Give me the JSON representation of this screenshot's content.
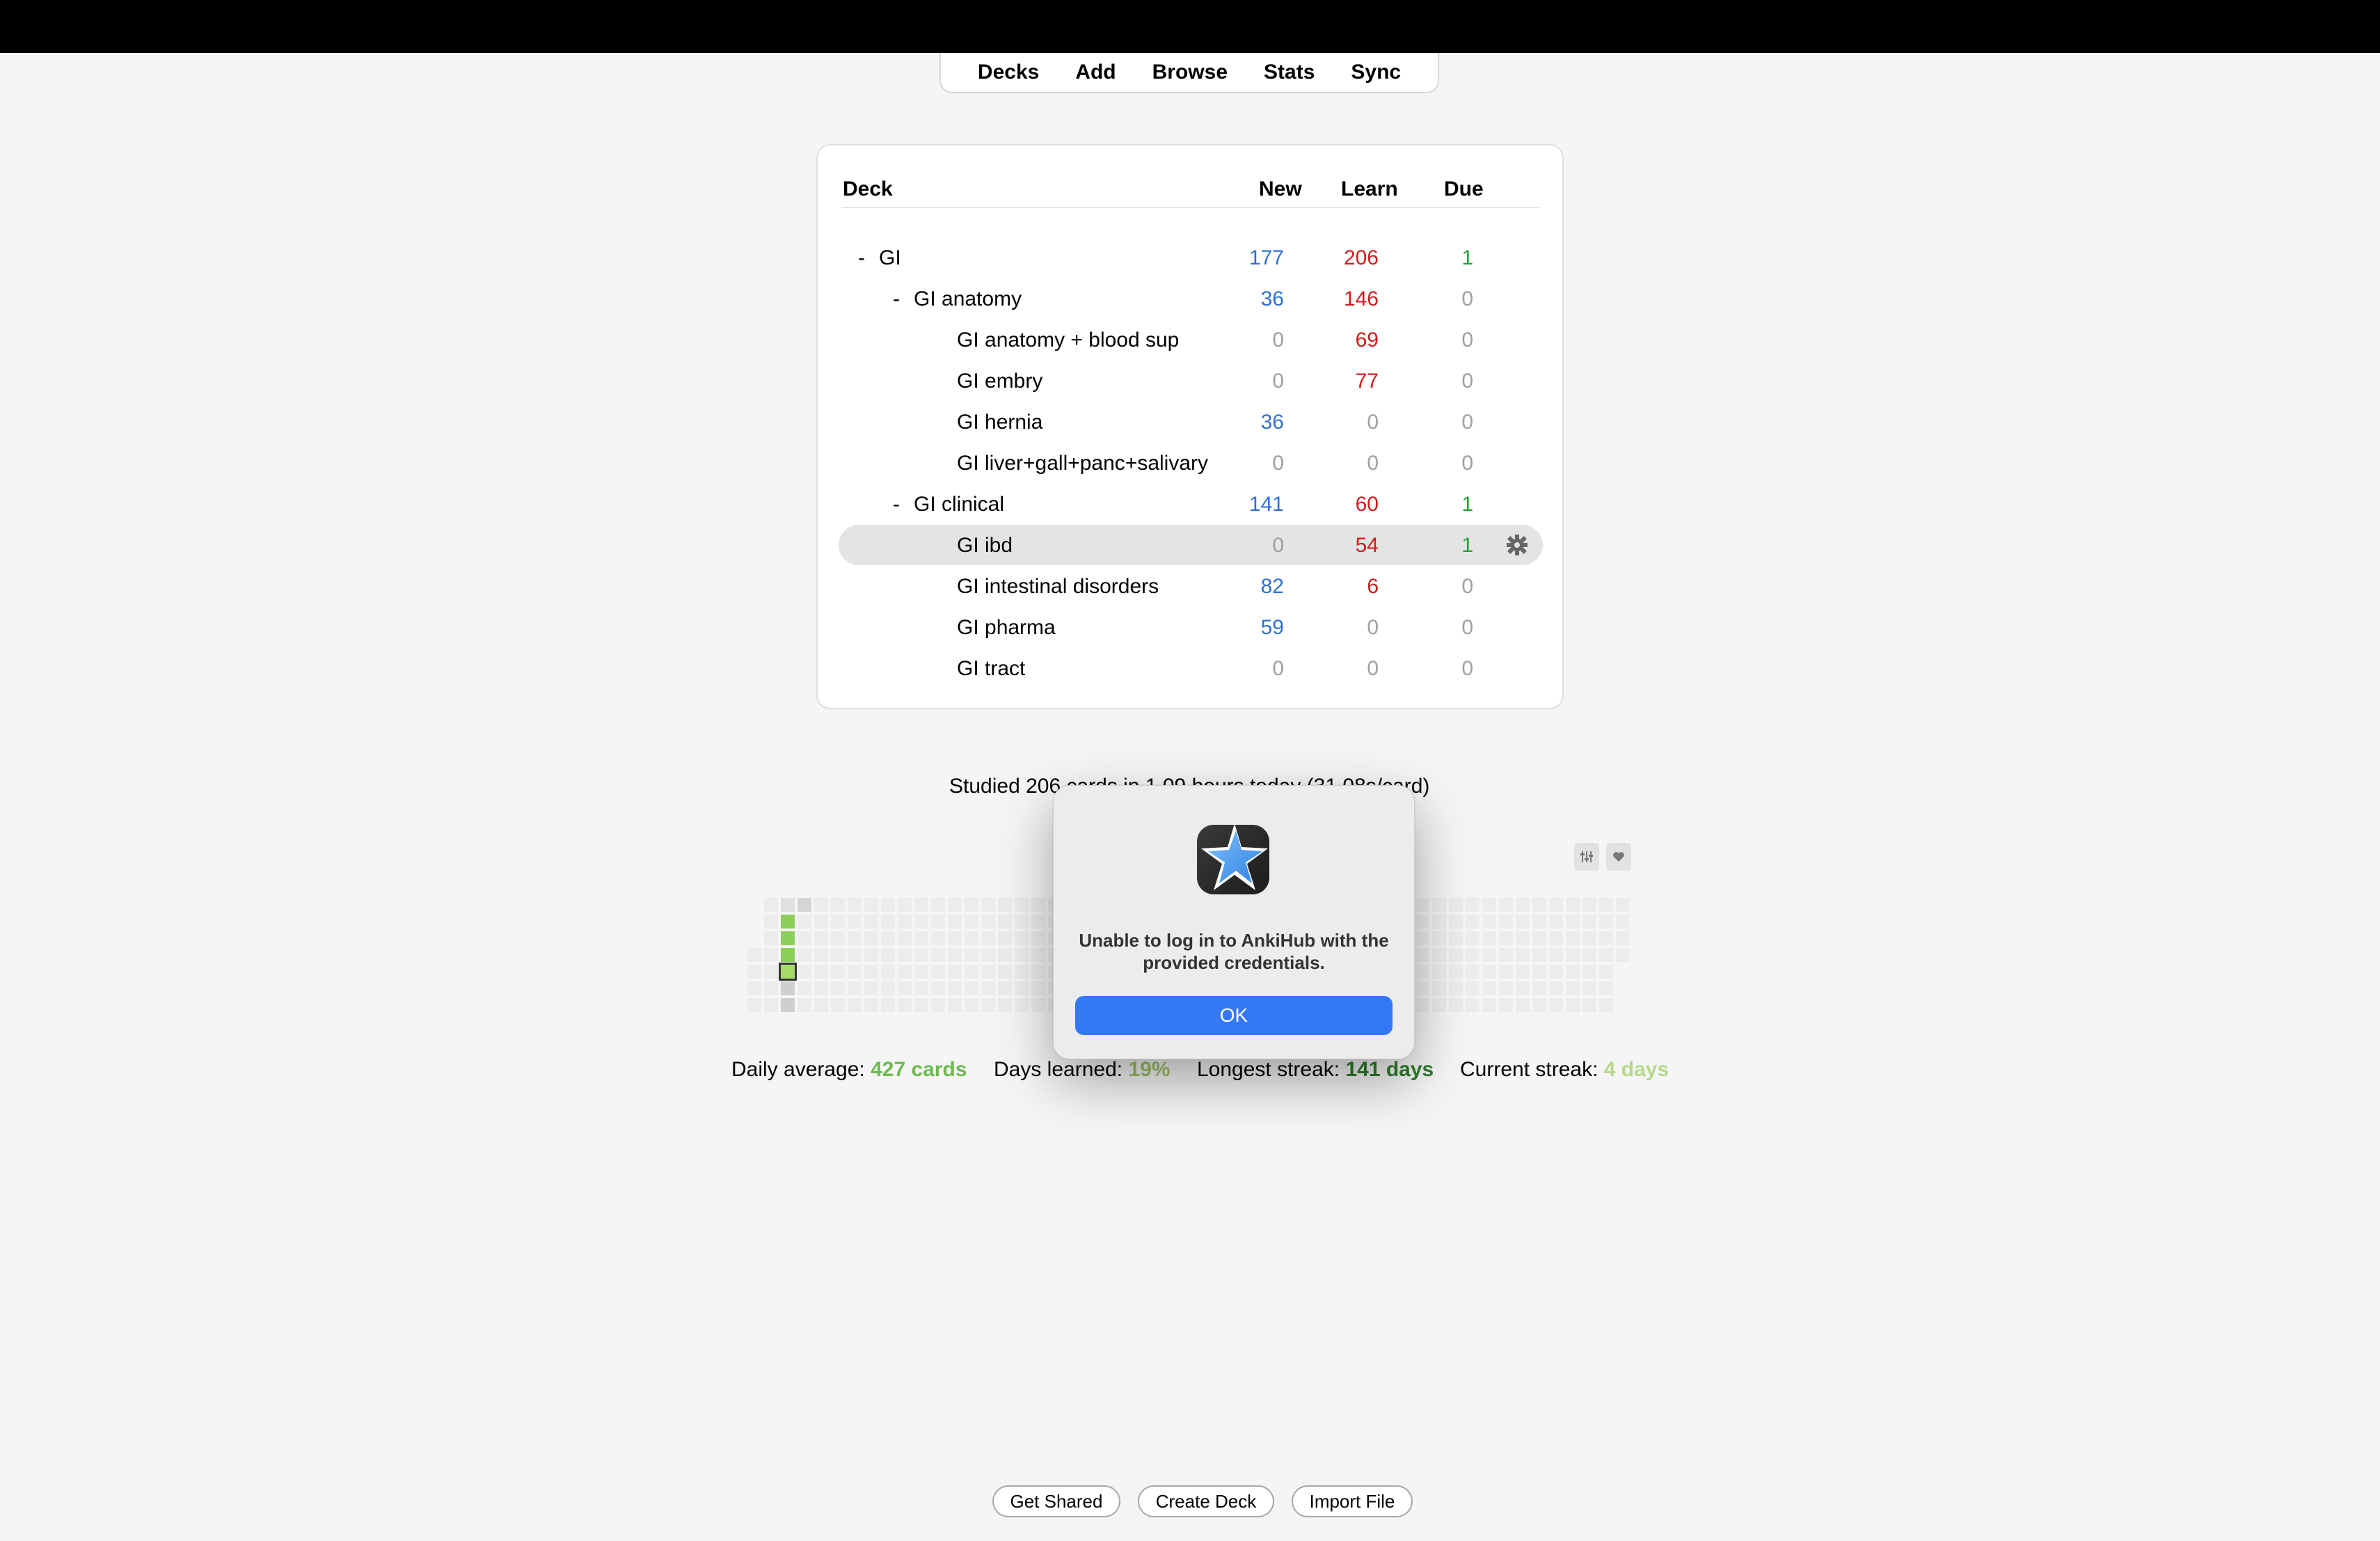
{
  "nav": [
    "Decks",
    "Add",
    "Browse",
    "Stats",
    "Sync"
  ],
  "deck_table": {
    "headers": {
      "deck": "Deck",
      "new": "New",
      "learn": "Learn",
      "due": "Due"
    },
    "rows": [
      {
        "name": "GI",
        "level": 0,
        "collapse": "-",
        "new": "177",
        "learn": "206",
        "due": "1"
      },
      {
        "name": "GI anatomy",
        "level": 1,
        "collapse": "-",
        "new": "36",
        "learn": "146",
        "due": "0"
      },
      {
        "name": "GI anatomy + blood sup",
        "level": 2,
        "collapse": "",
        "new": "0",
        "learn": "69",
        "due": "0"
      },
      {
        "name": "GI embry",
        "level": 2,
        "collapse": "",
        "new": "0",
        "learn": "77",
        "due": "0"
      },
      {
        "name": "GI hernia",
        "level": 2,
        "collapse": "",
        "new": "36",
        "learn": "0",
        "due": "0"
      },
      {
        "name": "GI liver+gall+panc+salivary",
        "level": 2,
        "collapse": "",
        "new": "0",
        "learn": "0",
        "due": "0"
      },
      {
        "name": "GI clinical",
        "level": 1,
        "collapse": "-",
        "new": "141",
        "learn": "60",
        "due": "1"
      },
      {
        "name": "GI ibd",
        "level": 2,
        "collapse": "",
        "new": "0",
        "learn": "54",
        "due": "1",
        "selected": true
      },
      {
        "name": "GI intestinal disorders",
        "level": 2,
        "collapse": "",
        "new": "82",
        "learn": "6",
        "due": "0"
      },
      {
        "name": "GI pharma",
        "level": 2,
        "collapse": "",
        "new": "59",
        "learn": "0",
        "due": "0"
      },
      {
        "name": "GI tract",
        "level": 2,
        "collapse": "",
        "new": "0",
        "learn": "0",
        "due": "0"
      }
    ]
  },
  "studied_text": "Studied 206 cards in 1.09 hours today (31.08s/card)",
  "stats": {
    "daily_average_label": "Daily average:",
    "daily_average_value": "427 cards",
    "days_learned_label": "Days learned:",
    "days_learned_value": "19%",
    "longest_streak_label": "Longest streak:",
    "longest_streak_value": "141 days",
    "current_streak_label": "Current streak:",
    "current_streak_value": "4 days"
  },
  "buttons": {
    "get_shared": "Get Shared",
    "create_deck": "Create Deck",
    "import_file": "Import File"
  },
  "dialog": {
    "message": "Unable to log in to AnkiHub with the provided credentials.",
    "ok": "OK"
  },
  "colors": {
    "new": "#2f6fd8",
    "learn": "#d01c1c",
    "due": "#26a136",
    "zero": "#a0a0a0",
    "accent": "#3478f6"
  }
}
